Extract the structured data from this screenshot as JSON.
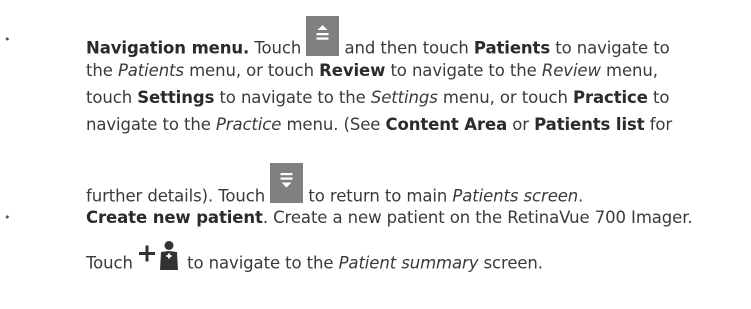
{
  "bullets": [
    {
      "symbol": "•",
      "line1": {
        "title": "Navigation menu.",
        "t1": " Touch ",
        "icon": "expand-menu-icon",
        "t2": " and then touch ",
        "kw1": "Patients",
        "t3": " to navigate to"
      },
      "line2": {
        "t1": "the ",
        "it1": "Patients",
        "t2": " menu, or touch ",
        "kw1": "Review",
        "t3": " to navigate to the ",
        "it2": "Review",
        "t4": " menu,"
      },
      "line3": {
        "t1": "touch ",
        "kw1": "Settings",
        "t2": " to navigate to the ",
        "it1": "Settings",
        "t3": " menu, or touch ",
        "kw2": "Practice",
        "t4": " to"
      },
      "line4": {
        "t1": "navigate to the ",
        "it1": "Practice",
        "t2": " menu. (See ",
        "kw1": "Content Area",
        "t3": " or ",
        "kw2": "Patients list",
        "t4": " for"
      },
      "line5": {
        "t1": "further details). Touch ",
        "icon": "collapse-menu-icon",
        "t2": " to return to main ",
        "it1": "Patients screen",
        "t3": "."
      }
    },
    {
      "symbol": "•",
      "line1": {
        "title": "Create new patient",
        "t1": ". Create a new patient on the RetinaVue 700 Imager."
      },
      "line2": {
        "t1": "Touch ",
        "icon": "add-patient-icon",
        "t2": " to navigate to the ",
        "it1": "Patient summary",
        "t3": " screen."
      }
    }
  ],
  "colors": {
    "text": "#3a3a3a",
    "icon_bg": "#808080",
    "icon_fg": "#ffffff",
    "add_icon": "#333333"
  }
}
